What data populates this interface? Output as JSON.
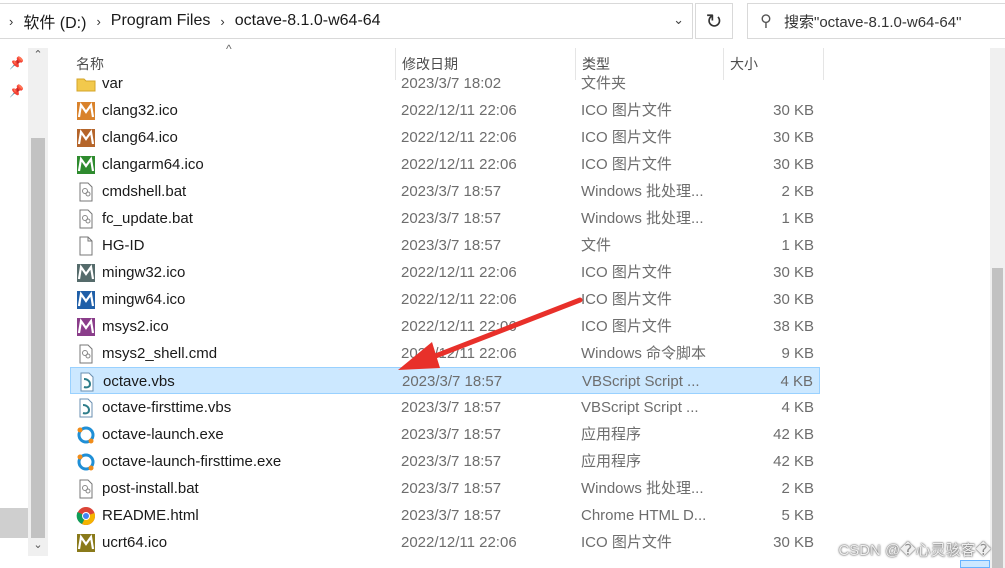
{
  "breadcrumb": [
    "软件 (D:)",
    "Program Files",
    "octave-8.1.0-w64-64"
  ],
  "search": {
    "text": "搜索\"octave-8.1.0-w64-64\""
  },
  "columns": {
    "name": "名称",
    "date": "修改日期",
    "type": "类型",
    "size": "大小"
  },
  "files": [
    {
      "name": "var",
      "date": "2023/3/7 18:02",
      "type": "文件夹",
      "size": "",
      "icon": "folder-icon"
    },
    {
      "name": "clang32.ico",
      "date": "2022/12/11 22:06",
      "type": "ICO 图片文件",
      "size": "30 KB",
      "icon": "ico-orange-icon"
    },
    {
      "name": "clang64.ico",
      "date": "2022/12/11 22:06",
      "type": "ICO 图片文件",
      "size": "30 KB",
      "icon": "ico-brown-icon"
    },
    {
      "name": "clangarm64.ico",
      "date": "2022/12/11 22:06",
      "type": "ICO 图片文件",
      "size": "30 KB",
      "icon": "ico-green-icon"
    },
    {
      "name": "cmdshell.bat",
      "date": "2023/3/7 18:57",
      "type": "Windows 批处理...",
      "size": "2 KB",
      "icon": "bat-file-icon"
    },
    {
      "name": "fc_update.bat",
      "date": "2023/3/7 18:57",
      "type": "Windows 批处理...",
      "size": "1 KB",
      "icon": "bat-file-icon"
    },
    {
      "name": "HG-ID",
      "date": "2023/3/7 18:57",
      "type": "文件",
      "size": "1 KB",
      "icon": "blank-file-icon"
    },
    {
      "name": "mingw32.ico",
      "date": "2022/12/11 22:06",
      "type": "ICO 图片文件",
      "size": "30 KB",
      "icon": "ico-gray-icon"
    },
    {
      "name": "mingw64.ico",
      "date": "2022/12/11 22:06",
      "type": "ICO 图片文件",
      "size": "30 KB",
      "icon": "ico-blue-icon"
    },
    {
      "name": "msys2.ico",
      "date": "2022/12/11 22:06",
      "type": "ICO 图片文件",
      "size": "38 KB",
      "icon": "ico-purple-icon"
    },
    {
      "name": "msys2_shell.cmd",
      "date": "2022/12/11 22:06",
      "type": "Windows 命令脚本",
      "size": "9 KB",
      "icon": "bat-file-icon"
    },
    {
      "name": "octave.vbs",
      "date": "2023/3/7 18:57",
      "type": "VBScript Script ...",
      "size": "4 KB",
      "icon": "vbs-file-icon",
      "selected": true
    },
    {
      "name": "octave-firsttime.vbs",
      "date": "2023/3/7 18:57",
      "type": "VBScript Script ...",
      "size": "4 KB",
      "icon": "vbs-file-icon"
    },
    {
      "name": "octave-launch.exe",
      "date": "2023/3/7 18:57",
      "type": "应用程序",
      "size": "42 KB",
      "icon": "octave-exe-icon"
    },
    {
      "name": "octave-launch-firsttime.exe",
      "date": "2023/3/7 18:57",
      "type": "应用程序",
      "size": "42 KB",
      "icon": "octave-exe-icon"
    },
    {
      "name": "post-install.bat",
      "date": "2023/3/7 18:57",
      "type": "Windows 批处理...",
      "size": "2 KB",
      "icon": "bat-file-icon"
    },
    {
      "name": "README.html",
      "date": "2023/3/7 18:57",
      "type": "Chrome HTML D...",
      "size": "5 KB",
      "icon": "chrome-html-icon"
    },
    {
      "name": "ucrt64.ico",
      "date": "2022/12/11 22:06",
      "type": "ICO 图片文件",
      "size": "30 KB",
      "icon": "ico-olive-icon"
    }
  ],
  "icon_colors": {
    "ico-orange-icon": "#d9822b",
    "ico-brown-icon": "#b5652a",
    "ico-green-icon": "#2e8b2e",
    "ico-gray-icon": "#556b6b",
    "ico-blue-icon": "#1f5fa8",
    "ico-purple-icon": "#8a3d8a",
    "ico-olive-icon": "#8a7a1a"
  },
  "selection_color": "#cce8ff",
  "arrow_color": "#e8302a",
  "watermark": "CSDN @�心灵骇客�"
}
